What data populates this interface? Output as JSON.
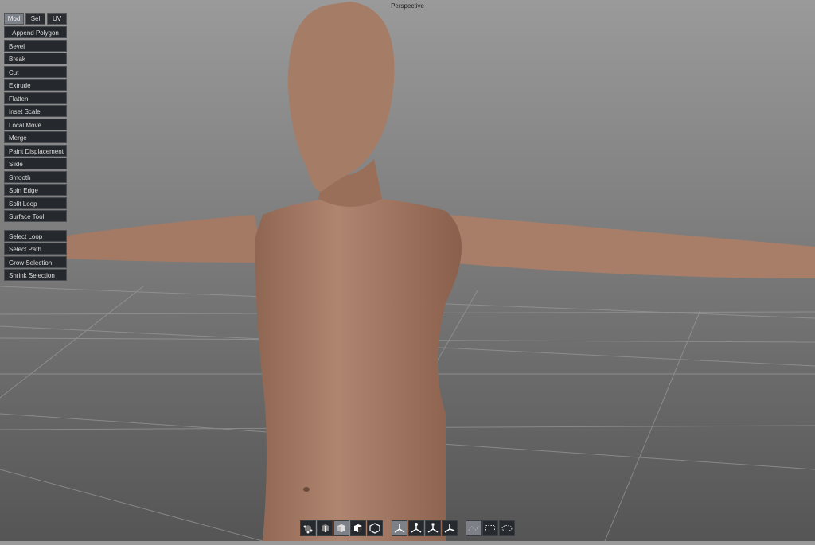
{
  "viewport": {
    "title": "Perspective"
  },
  "panel": {
    "tabs": [
      {
        "label": "Mod",
        "active": true
      },
      {
        "label": "Sel",
        "active": false
      },
      {
        "label": "UV",
        "active": false
      }
    ],
    "mod_tools": [
      "Append Polygon",
      "Bevel",
      "Break",
      "Cut",
      "Extrude",
      "Flatten",
      "Inset Scale",
      "Local Move",
      "Merge",
      "Paint Displacement",
      "Slide",
      "Smooth",
      "Spin Edge",
      "Split Loop",
      "Surface Tool"
    ],
    "sel_tools": [
      "Select Loop",
      "Select Path",
      "Grow Selection",
      "Shrink Selection"
    ]
  },
  "toolbar": {
    "groups": [
      [
        "vertex-mode-icon",
        "edge-mode-icon",
        "face-mode-icon",
        "object-mode-icon",
        "multi-mode-icon"
      ],
      [
        "move-icon",
        "rotate-icon",
        "scale-icon",
        "universal-manipulator-icon"
      ],
      [
        "lasso-select-icon",
        "rectangle-select-icon",
        "paint-select-icon"
      ]
    ],
    "active": [
      "face-mode-icon",
      "move-icon",
      "lasso-select-icon"
    ]
  },
  "colors": {
    "skin": "#a47a64",
    "panel_bg": "#25282c",
    "active_tab": "#7c8088"
  }
}
